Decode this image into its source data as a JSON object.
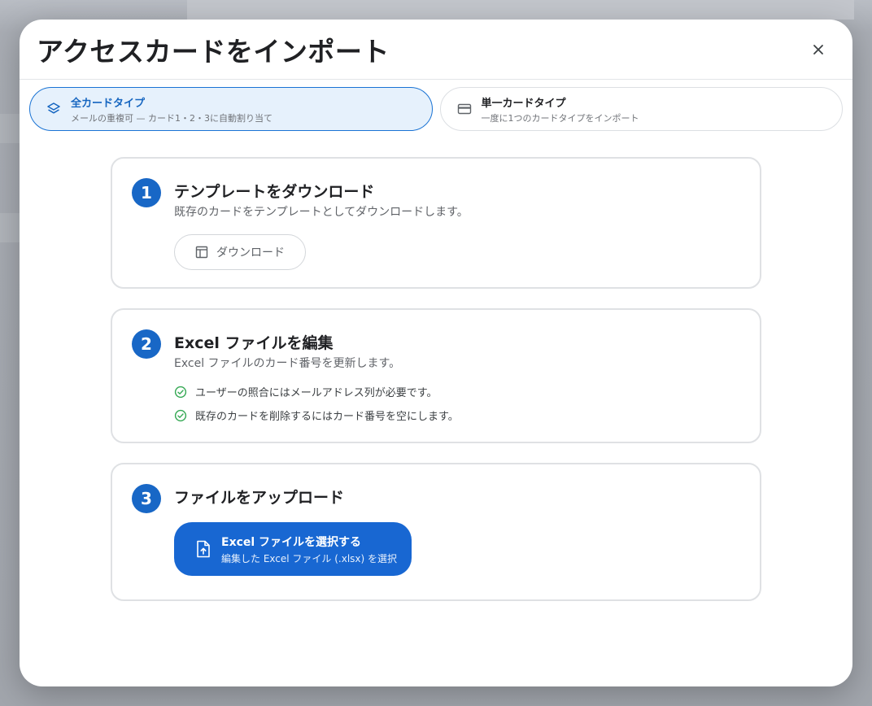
{
  "dialog": {
    "title": "アクセスカードをインポート",
    "close_icon": "close-icon"
  },
  "tabs": [
    {
      "title": "全カードタイプ",
      "subtitle": "メールの重複可 — カード1・2・3に自動割り当て",
      "icon": "layers-icon",
      "active": true
    },
    {
      "title": "単一カードタイプ",
      "subtitle": "一度に1つのカードタイプをインポート",
      "icon": "credit-card-icon",
      "active": false
    }
  ],
  "steps": {
    "one": {
      "number": "1",
      "title": "テンプレートをダウンロード",
      "description": "既存のカードをテンプレートとしてダウンロードします。",
      "button_label": "ダウンロード",
      "button_icon": "table-icon"
    },
    "two": {
      "number": "2",
      "title": "Excel ファイルを編集",
      "description": "Excel ファイルのカード番号を更新します。",
      "checks": [
        "ユーザーの照合にはメールアドレス列が必要です。",
        "既存のカードを削除するにはカード番号を空にします。"
      ]
    },
    "three": {
      "number": "3",
      "title": "ファイルをアップロード",
      "button_title": "Excel ファイルを選択する",
      "button_subtitle": "編集した Excel ファイル (.xlsx) を選択",
      "button_icon": "file-upload-icon"
    }
  },
  "colors": {
    "primary": "#1867d2",
    "active_tab_bg": "#e6f1fc",
    "check_green": "#34a853"
  }
}
